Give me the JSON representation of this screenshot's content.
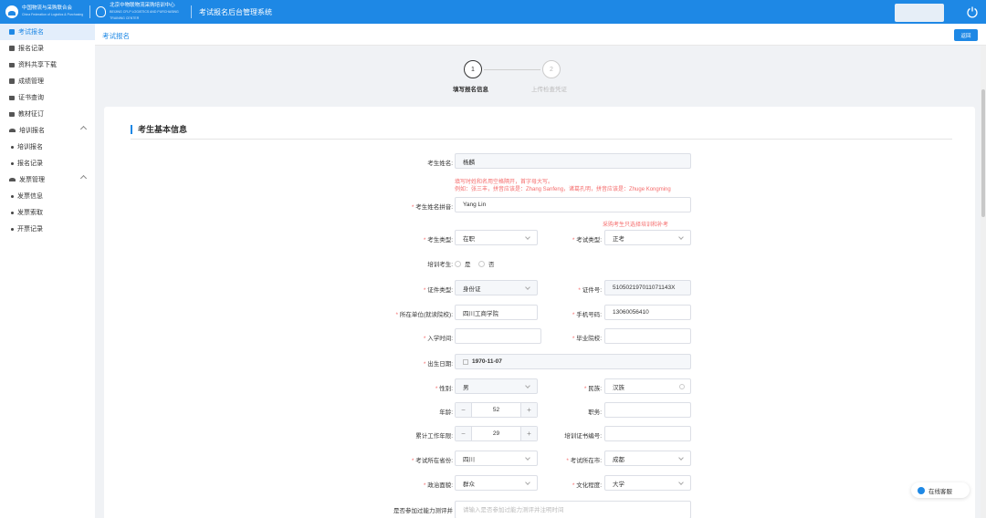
{
  "header": {
    "org1_name": "中国物流与采购联合会",
    "org1_sub": "China Federation of Logistics & Purchasing",
    "org2_name": "北京中物联物流采购培训中心",
    "org2_sub": "BEIJING CFLP LOGISTICS AND PURCHASING TRAINING CENTER",
    "system_title": "考试报名后台管理系统"
  },
  "sidebar": {
    "items": [
      {
        "label": "考试报名",
        "active": true
      },
      {
        "label": "报名记录"
      },
      {
        "label": "资料共享下载"
      },
      {
        "label": "成绩管理"
      },
      {
        "label": "证书查询"
      },
      {
        "label": "教材征订"
      }
    ],
    "groups": [
      {
        "label": "培训报名",
        "children": [
          "培训报名",
          "报名记录"
        ]
      },
      {
        "label": "发票管理",
        "children": [
          "发票信息",
          "发票索取",
          "开票记录"
        ]
      }
    ]
  },
  "breadcrumb": {
    "current": "考试报名",
    "back_label": "返回"
  },
  "steps": [
    {
      "number": "1",
      "label": "填写报名信息"
    },
    {
      "number": "2",
      "label": "上传检查凭证"
    }
  ],
  "form": {
    "section_title": "考生基本信息",
    "name_label": "考生姓名:",
    "name_value": "杨麟",
    "hint_name_lines": [
      "填写时姓和名用空格隔开，首字母大写。",
      "例如：张三丰，拼音应该是：Zhang Sanfeng，诸葛孔明，拼音应该是：Zhuge Kongming"
    ],
    "pinyin_label": "考生姓名拼音:",
    "pinyin_value": "Yang Lin",
    "hint_exam_type": "采购考生只选择培训和补考",
    "candidate_type_label": "考生类型:",
    "candidate_type_value": "在职",
    "exam_type_label": "考试类型:",
    "exam_type_value": "正考",
    "trainee_label": "培训考生:",
    "trainee_yes": "是",
    "trainee_no": "否",
    "id_type_label": "证件类型:",
    "id_type_value": "身份证",
    "id_no_label": "证件号:",
    "id_no_value": "510502197011071143X",
    "employer_label": "所在单位(就读院校):",
    "employer_value": "四川工商学院",
    "phone_label": "手机号码:",
    "phone_value": "13060056410",
    "enroll_time_label": "入学时间:",
    "graduate_school_label": "毕业院校:",
    "birth_label": "出生日期:",
    "birth_value": "1970-11-07",
    "gender_label": "性别:",
    "gender_value": "男",
    "ethnicity_label": "民族:",
    "ethnicity_value": "汉族",
    "age_label": "年龄:",
    "age_value": "52",
    "position_label": "职务:",
    "work_years_label": "累计工作年限:",
    "work_years_value": "29",
    "training_cert_label": "培训证书编号:",
    "exam_province_label": "考试所在省份:",
    "exam_province_value": "四川",
    "exam_city_label": "考试所在市:",
    "exam_city_value": "成都",
    "political_label": "政治面貌:",
    "political_value": "群众",
    "education_label": "文化程度:",
    "education_value": "大学",
    "ability_label": "是否参加过能力测评并",
    "ability_placeholder": "请输入是否参加过能力测评并注明时间"
  },
  "online_service": "在线客服",
  "colors": {
    "primary": "#1e88e5",
    "danger": "#f56c6c"
  }
}
